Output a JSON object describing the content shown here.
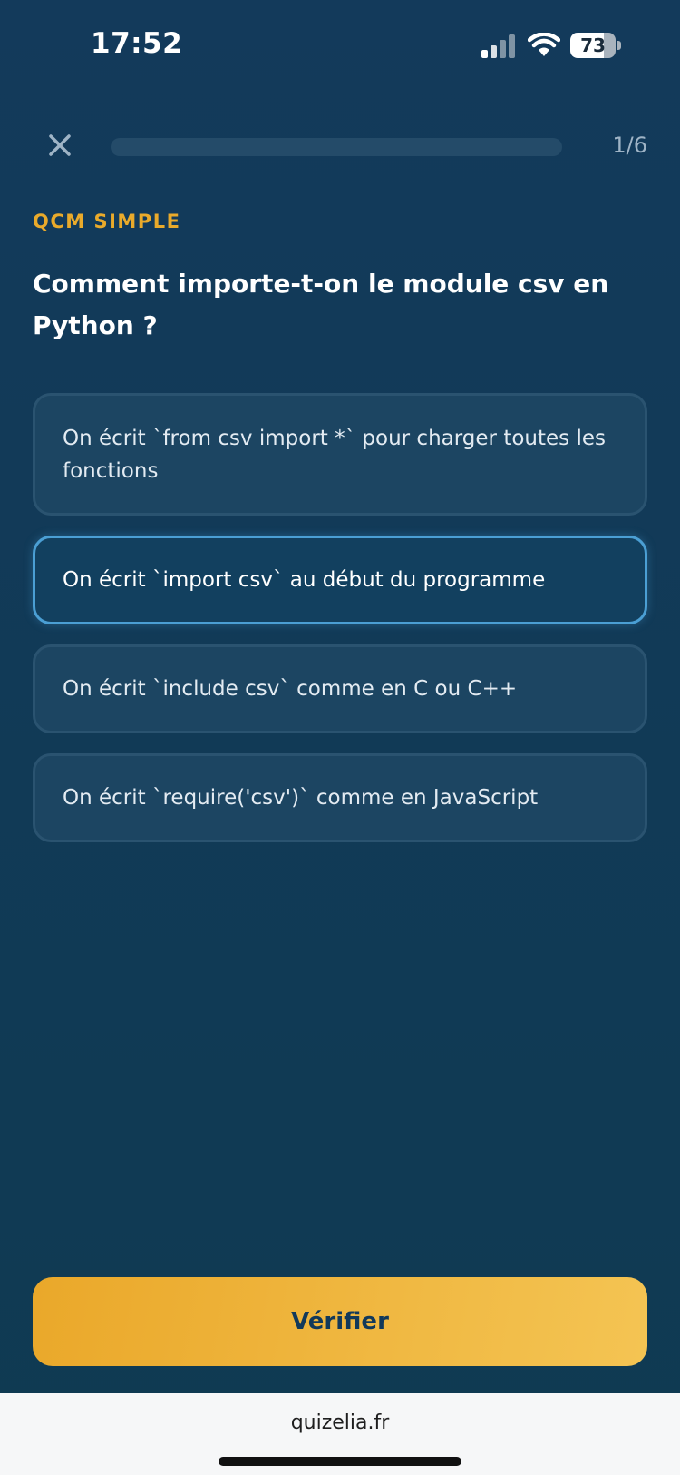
{
  "status_bar": {
    "time": "17:52",
    "battery_level": "73",
    "battery_fraction": 0.73,
    "icons": [
      "signal-icon",
      "wifi-icon",
      "battery-icon"
    ]
  },
  "header": {
    "close_icon": "close-icon",
    "progress_label": "1/6",
    "progress_fraction": 0.0
  },
  "question": {
    "type_label": "QCM SIMPLE",
    "text": "Comment importe-t-on le module csv en Python ?"
  },
  "options": [
    {
      "label": "On écrit `from csv import *` pour charger toutes les fonctions",
      "selected": false
    },
    {
      "label": "On écrit `import csv` au début du programme",
      "selected": true
    },
    {
      "label": "On écrit `include csv` comme en C ou C++",
      "selected": false
    },
    {
      "label": "On écrit `require('csv')` comme en JavaScript",
      "selected": false
    }
  ],
  "actions": {
    "verify_label": "Vérifier"
  },
  "browser": {
    "url": "quizelia.fr"
  },
  "colors": {
    "background": "#12395a",
    "accent": "#eaa82a",
    "selected_border": "#4b9fd4"
  }
}
